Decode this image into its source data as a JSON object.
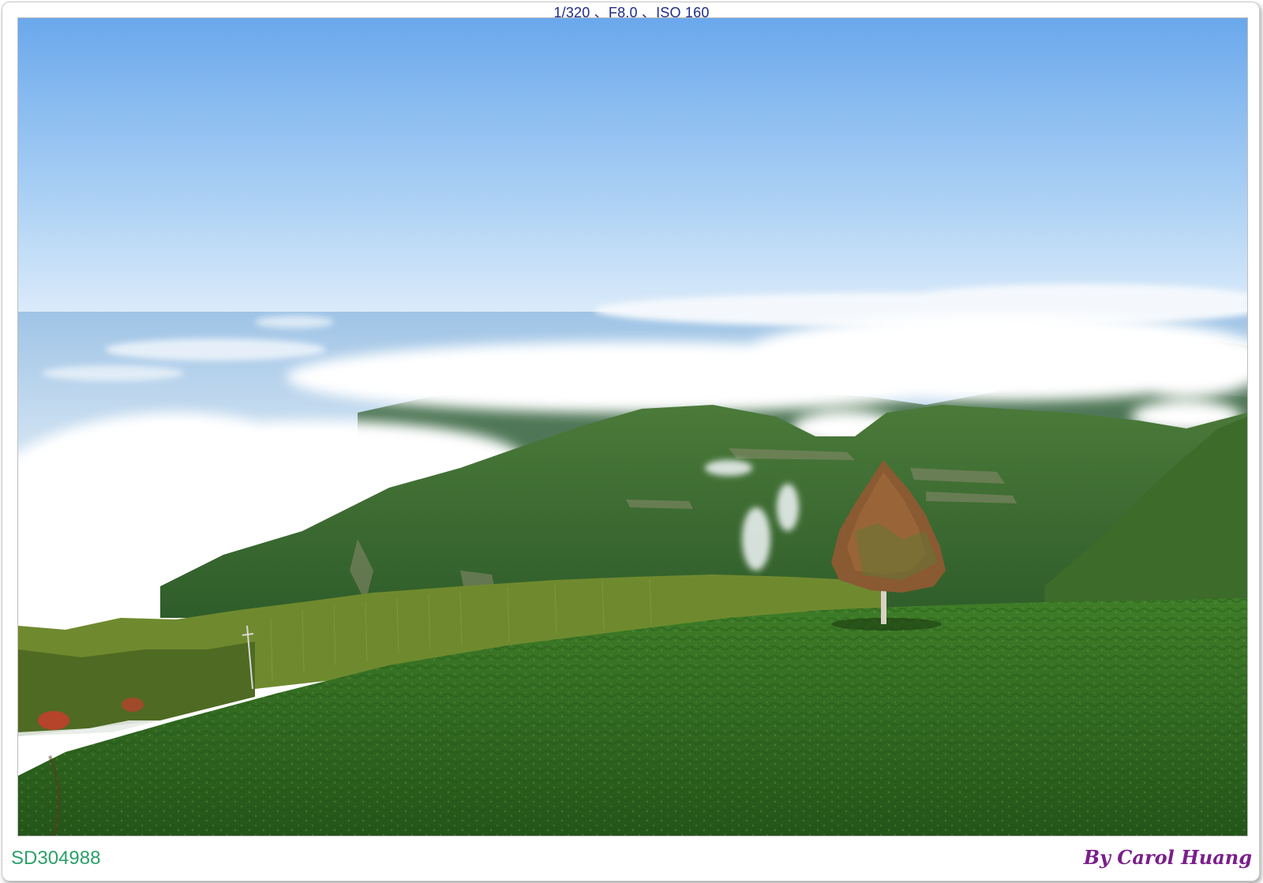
{
  "exif": "1/320 、F8.0 、ISO 160",
  "photo_id": "SD304988",
  "credit": "By Carol Huang",
  "colors": {
    "exif_text": "#1e2c8c",
    "photo_id_text": "#2aa06a",
    "credit_text": "#7a1f8a",
    "sky_top": "#6aa8ec",
    "sky_horizon": "#dcecfa",
    "tea_field": "#2f6b1f"
  }
}
